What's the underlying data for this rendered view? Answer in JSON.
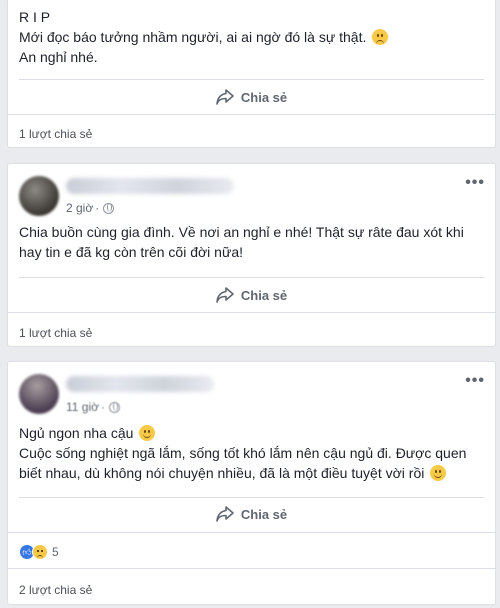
{
  "posts": [
    {
      "lines": [
        "R I P",
        "Mới đọc báo tưởng nhầm người, ai ai ngờ đó là sự thật.",
        "An nghỉ nhé."
      ],
      "line_emoji": "worried-face",
      "share_label": "Chia sẻ",
      "share_count": "1 lượt chia sẻ"
    },
    {
      "time": "2 giờ",
      "lines": [
        "Chia buồn cùng gia đình. Về nơi an nghỉ e nhé! Thật sự râte đau xót khi",
        "hay tin e đã kg còn trên cõi đời nữa!"
      ],
      "share_label": "Chia sẻ",
      "share_count": "1 lượt chia sẻ"
    },
    {
      "time": "11 giờ",
      "lines": [
        "Ngủ ngon nha cậu",
        "Cuộc sống nghiệt ngã lắm, sống tốt khó lắm nên cậu ngủ đi. Được quen",
        "biết nhau, dù không nói chuyện nhiều, đã là một điều tuyệt vời rồi"
      ],
      "share_label": "Chia sẻ",
      "reaction_count": "5",
      "share_count": "2 lượt chia sẻ"
    }
  ],
  "icons": {
    "share": "share-arrow-icon",
    "more": "more-options-icon",
    "privacy": "globe-icon",
    "like": "like-reaction-icon",
    "sad": "sad-reaction-icon"
  },
  "colors": {
    "like_blue": "#3578e5",
    "emoji_yellow": "#f7c948",
    "background": "#e9ebee"
  }
}
